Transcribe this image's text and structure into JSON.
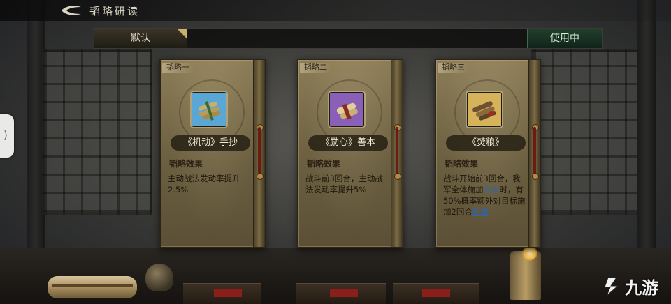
{
  "header": {
    "title": "韬略研读",
    "back_icon": "back-arrow-icon"
  },
  "tabs": {
    "default_label": "默认",
    "in_use_label": "使用中"
  },
  "cards": [
    {
      "tag": "韬略一",
      "name": "《机动》手抄",
      "effect_title": "韬略效果",
      "effect_text": "主动战法发动率提升2.5%",
      "icon": "scroll-bundle-blue-icon",
      "icon_bg": "#5aa7d6"
    },
    {
      "tag": "韬略二",
      "name": "《励心》善本",
      "effect_title": "韬略效果",
      "effect_text": "战斗前3回合，主动战法发动率提升5%",
      "icon": "scroll-bundle-purple-icon",
      "icon_bg": "#8a5fb8"
    },
    {
      "tag": "韬略三",
      "name": "《焚粮》",
      "effect_title": "韬略效果",
      "effect_part1": "战斗开始前3回合，我军全体施加",
      "effect_link1": "火攻",
      "effect_part2": "时，有50%概率额外对目标施加2回合",
      "effect_link2": "断粮",
      "icon": "scroll-bundle-gold-icon",
      "icon_bg": "#d6b25a"
    }
  ],
  "side_handle": {
    "glyph": "⟩"
  },
  "watermark": {
    "text": "九游"
  },
  "colors": {
    "accent_gold": "#c9b16a",
    "in_use_green": "#22402c",
    "link_blue": "#2a66b8"
  }
}
